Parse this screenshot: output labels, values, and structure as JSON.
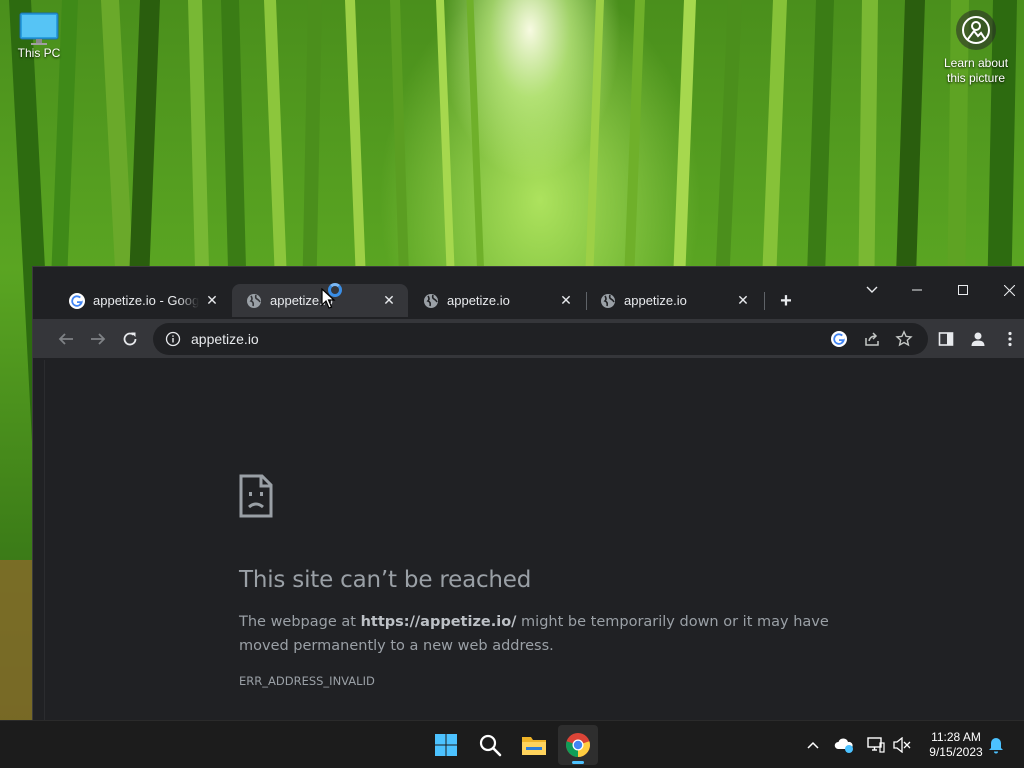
{
  "desktop": {
    "icons": [
      {
        "label": "This PC",
        "icon": "monitor-icon"
      },
      {
        "label": "Learn about this picture",
        "icon": "camera-icon"
      }
    ]
  },
  "browser": {
    "tabs": [
      {
        "title": "appetize.io - Google Search",
        "favicon": "google-icon",
        "active": false
      },
      {
        "title": "appetize.io",
        "favicon": "globe-icon",
        "active": true
      },
      {
        "title": "appetize.io",
        "favicon": "globe-icon",
        "active": false
      },
      {
        "title": "appetize.io",
        "favicon": "globe-icon",
        "active": false
      }
    ],
    "address": "appetize.io",
    "error": {
      "heading": "This site can’t be reached",
      "body_prefix": "The webpage at ",
      "body_url": "https://appetize.io/",
      "body_suffix": " might be temporarily down or it may have moved permanently to a new web address.",
      "code": "ERR_ADDRESS_INVALID"
    }
  },
  "taskbar": {
    "apps": [
      "start-icon",
      "search-icon",
      "file-explorer-icon",
      "chrome-icon"
    ],
    "time": "11:28 AM",
    "date": "9/15/2023"
  },
  "colors": {
    "chrome_frame": "#202124",
    "chrome_toolbar": "#35363a",
    "taskbar": "#1c1c1c",
    "accent": "#4cc2ff"
  }
}
